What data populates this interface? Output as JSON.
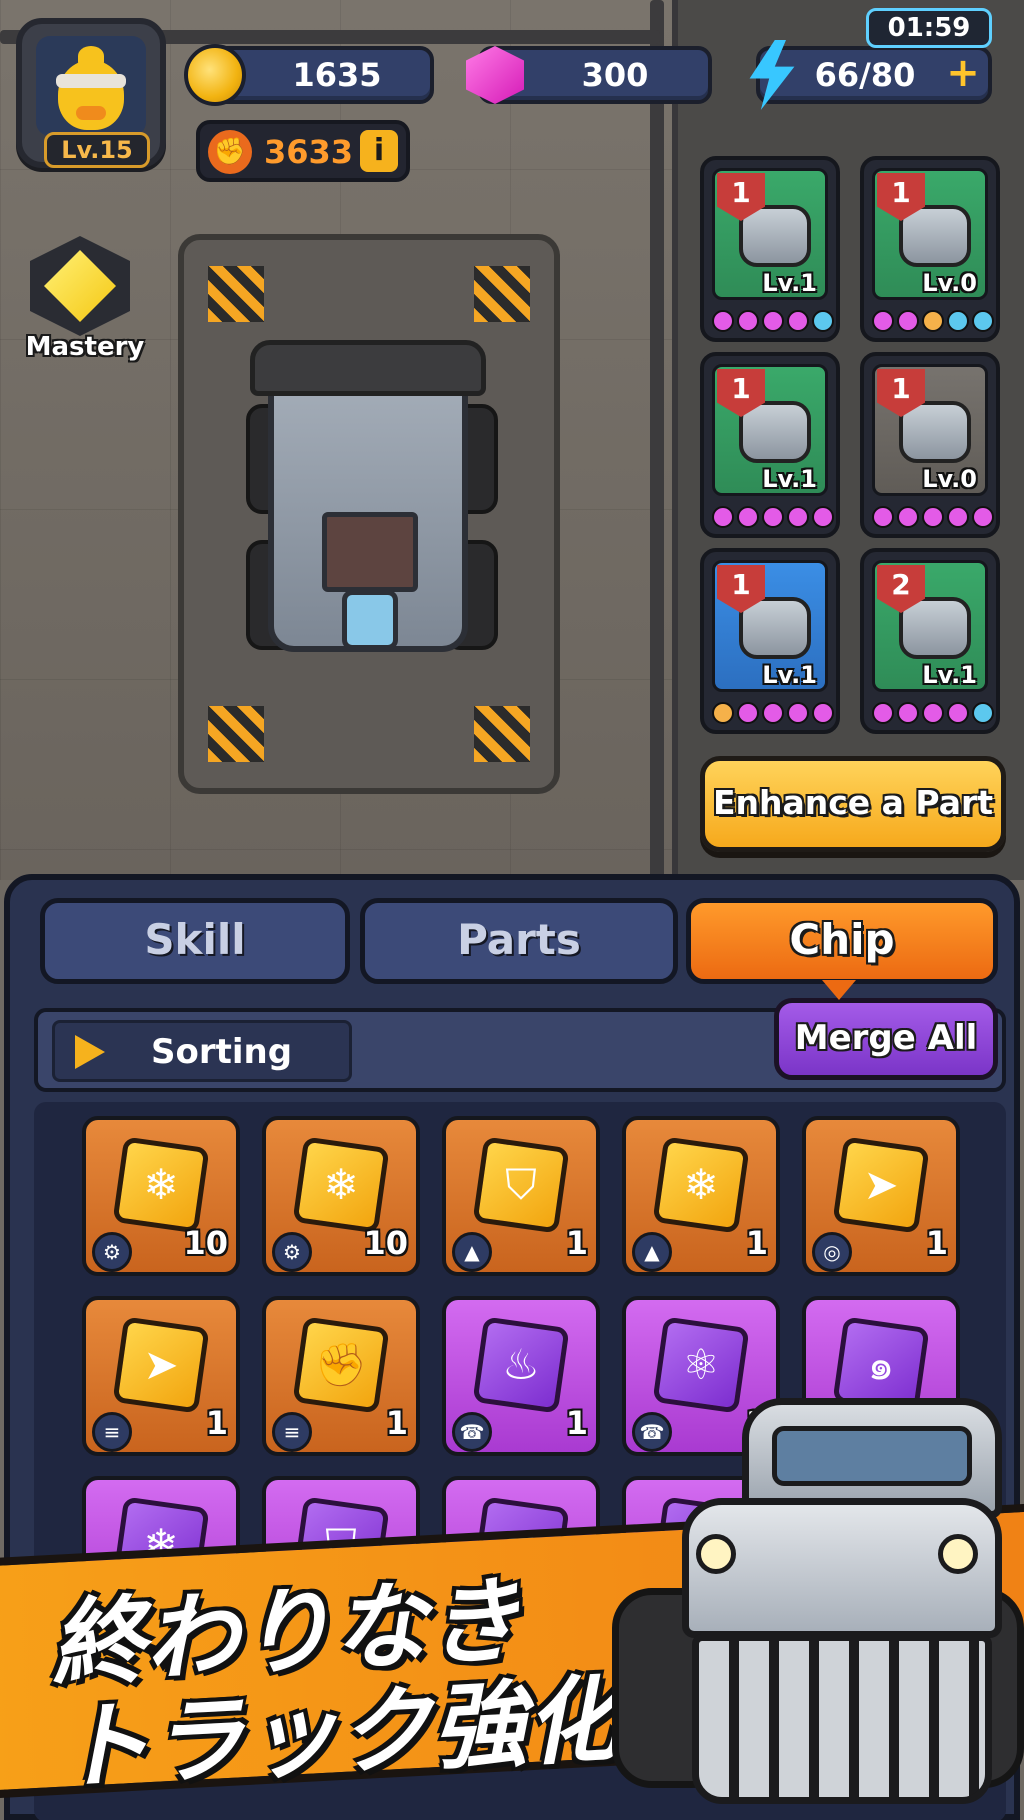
{
  "hud": {
    "player_level": "Lv.15",
    "coins": "1635",
    "gems": "300",
    "energy": "66/80",
    "timer": "01:59",
    "power": "3633"
  },
  "mastery": {
    "label": "Mastery"
  },
  "parts": [
    {
      "count": "1",
      "level": "Lv.1",
      "bg": "green",
      "dots": [
        "#e35be7",
        "#e35be7",
        "#e35be7",
        "#e35be7",
        "#5cc8ee"
      ]
    },
    {
      "count": "1",
      "level": "Lv.0",
      "bg": "green",
      "dots": [
        "#e35be7",
        "#e35be7",
        "#f5b14a",
        "#5cc8ee",
        "#5cc8ee"
      ]
    },
    {
      "count": "1",
      "level": "Lv.1",
      "bg": "green",
      "dots": [
        "#e35be7",
        "#e35be7",
        "#e35be7",
        "#e35be7",
        "#e35be7"
      ]
    },
    {
      "count": "1",
      "level": "Lv.0",
      "bg": "gray",
      "dots": [
        "#e35be7",
        "#e35be7",
        "#e35be7",
        "#e35be7",
        "#e35be7"
      ]
    },
    {
      "count": "1",
      "level": "Lv.1",
      "bg": "blue",
      "dots": [
        "#f5b14a",
        "#e35be7",
        "#e35be7",
        "#e35be7",
        "#e35be7"
      ]
    },
    {
      "count": "2",
      "level": "Lv.1",
      "bg": "green",
      "dots": [
        "#e35be7",
        "#e35be7",
        "#e35be7",
        "#e35be7",
        "#5cc8ee"
      ]
    }
  ],
  "enhance_label": "Enhance a Part",
  "tabs": {
    "skill": "Skill",
    "parts": "Parts",
    "chip": "Chip"
  },
  "sorting_label": "Sorting",
  "merge_label": "Merge All",
  "chips": [
    {
      "tier": "gold",
      "symbol": "❄",
      "type": "⚙",
      "count": "10"
    },
    {
      "tier": "gold",
      "symbol": "❄",
      "type": "⚙",
      "count": "10"
    },
    {
      "tier": "gold",
      "symbol": "⛉",
      "type": "▲",
      "count": "1"
    },
    {
      "tier": "gold",
      "symbol": "❄",
      "type": "▲",
      "count": "1"
    },
    {
      "tier": "gold",
      "symbol": "➤",
      "type": "◎",
      "count": "1"
    },
    {
      "tier": "gold",
      "symbol": "➤",
      "type": "≡",
      "count": "1"
    },
    {
      "tier": "gold",
      "symbol": "✊",
      "type": "≡",
      "count": "1"
    },
    {
      "tier": "purple",
      "symbol": "♨",
      "type": "☎",
      "count": "1"
    },
    {
      "tier": "purple",
      "symbol": "⚛",
      "type": "☎",
      "count": "1"
    },
    {
      "tier": "purple",
      "symbol": "๑",
      "type": "",
      "count": ""
    },
    {
      "tier": "purple",
      "symbol": "❄",
      "type": "",
      "count": ""
    },
    {
      "tier": "purple",
      "symbol": "⛉",
      "type": "",
      "count": ""
    },
    {
      "tier": "purple",
      "symbol": "●",
      "type": "",
      "count": ""
    },
    {
      "tier": "purple",
      "symbol": "◆",
      "type": "",
      "count": ""
    }
  ],
  "promo": {
    "line1": "終わりなき",
    "line2": "トラック強化!"
  },
  "colors": {
    "accent": "#ec6a12",
    "panel": "#2a3350",
    "merge": "#7b35c8"
  }
}
